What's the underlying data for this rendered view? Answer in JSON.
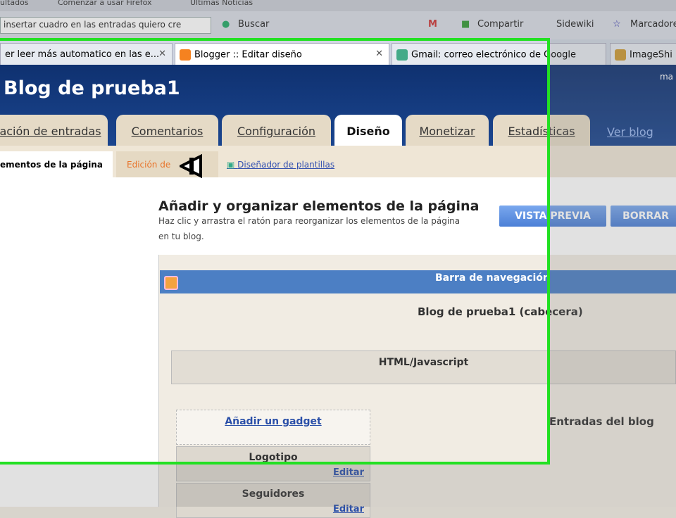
{
  "bookmarks": [
    "ultados",
    "Comenzar a usar Firefox",
    "Últimas Noticias"
  ],
  "toolbar": {
    "address": "insertar cuadro en las entradas quiero cre",
    "buscar": "Buscar",
    "compartir": "Compartir",
    "sidewiki": "Sidewiki",
    "marcadores": "Marcadores"
  },
  "tabs": [
    {
      "label": "er leer más automatico en las e..."
    },
    {
      "label": "Blogger :: Editar diseño"
    },
    {
      "label": "Gmail: correo electrónico de Google"
    },
    {
      "label": "ImageShi"
    }
  ],
  "header": {
    "blog_title": "Blog de prueba1",
    "user": "ma"
  },
  "main_tabs": [
    "ación de entradas",
    "Comentarios",
    "Configuración",
    "Diseño",
    "Monetizar",
    "Estadísticas"
  ],
  "ver_blog": "Ver blog",
  "sub_tabs": [
    "ementos de la página",
    "Edición de",
    "Diseñador de plantillas"
  ],
  "content": {
    "heading": "Añadir y organizar elementos de la página",
    "description": "Haz clic y arrastra el ratón para reorganizar los elementos de la página en tu blog.",
    "preview": "VISTA PREVIA",
    "clear": "BORRAR"
  },
  "layout": {
    "navbar": "Barra de navegación",
    "header": "Blog de prueba1 (cabecera)",
    "html": "HTML/Javascript",
    "add_gadget": "Añadir un gadget",
    "posts": "Entradas del blog",
    "widgets": [
      {
        "name": "Logotipo",
        "edit": "Editar"
      },
      {
        "name": "Seguidores",
        "edit": "Editar"
      }
    ]
  }
}
